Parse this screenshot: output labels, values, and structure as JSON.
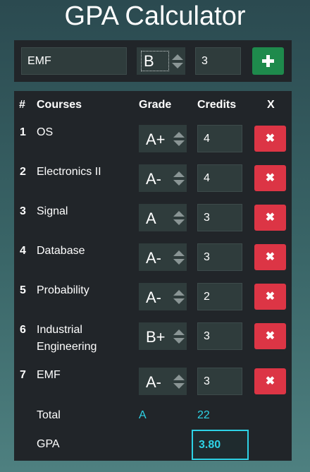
{
  "title": "GPA Calculator",
  "add_form": {
    "course_value": "EMF",
    "grade_value": "B",
    "credits_value": "3",
    "add_icon": "plus-icon"
  },
  "table": {
    "headers": {
      "index": "#",
      "courses": "Courses",
      "grade": "Grade",
      "credits": "Credits",
      "remove": "X"
    },
    "rows": [
      {
        "index": "1",
        "name": "OS",
        "grade": "A+",
        "credits": "4"
      },
      {
        "index": "2",
        "name": "Electronics II",
        "grade": "A-",
        "credits": "4"
      },
      {
        "index": "3",
        "name": "Signal",
        "grade": "A",
        "credits": "3"
      },
      {
        "index": "4",
        "name": "Database",
        "grade": "A-",
        "credits": "3"
      },
      {
        "index": "5",
        "name": "Probability",
        "grade": "A-",
        "credits": "2"
      },
      {
        "index": "6",
        "name": "Industrial Engineering",
        "grade": "B+",
        "credits": "3"
      },
      {
        "index": "7",
        "name": "EMF",
        "grade": "A-",
        "credits": "3"
      }
    ],
    "delete_label": "✖",
    "total_label": "Total",
    "total_grade": "A",
    "total_credits": "22",
    "gpa_label": "GPA",
    "gpa_value": "3.80"
  },
  "colors": {
    "panel": "#212529",
    "add_button": "#1e8a4c",
    "delete_button": "#dc3545",
    "accent": "#2ed3e6"
  }
}
